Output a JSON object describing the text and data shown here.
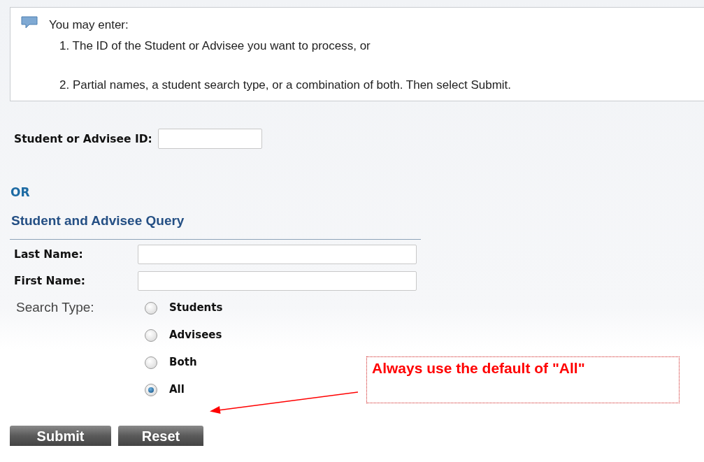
{
  "info": {
    "heading": "You may enter:",
    "items": [
      "1. The ID of the Student or Advisee you want to process, or",
      "2. Partial names, a student search type, or a combination of both. Then select Submit."
    ]
  },
  "id_field": {
    "label": "Student or Advisee ID:"
  },
  "or_label": "OR",
  "query": {
    "title": "Student and Advisee Query",
    "fields": [
      {
        "label": "Last Name:"
      },
      {
        "label": "First Name:"
      }
    ],
    "search_type": {
      "label": "Search Type:",
      "options": [
        {
          "label": "Students",
          "selected": false
        },
        {
          "label": "Advisees",
          "selected": false
        },
        {
          "label": "Both",
          "selected": false
        },
        {
          "label": "All",
          "selected": true
        }
      ]
    }
  },
  "callout": {
    "text": "Always use the default of \"All\""
  },
  "buttons": [
    "Submit",
    "Reset"
  ]
}
